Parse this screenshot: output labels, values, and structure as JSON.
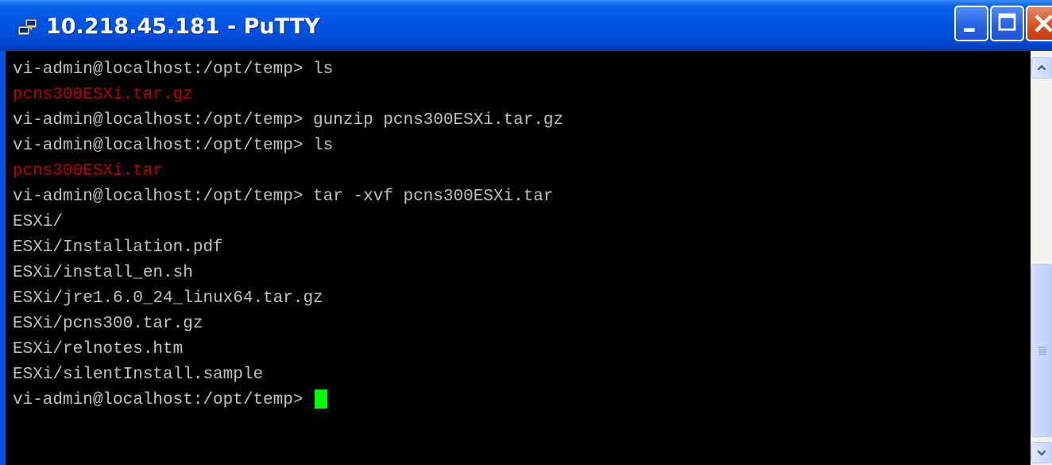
{
  "window": {
    "title": "10.218.45.181 - PuTTY",
    "icon": "putty-icon",
    "controls": [
      "minimize-icon",
      "maximize-icon",
      "close-icon"
    ]
  },
  "terminal": {
    "lines": [
      {
        "text": "vi-admin@localhost:/opt/temp> ls",
        "color": "#c0c0c0"
      },
      {
        "text": "pcns300ESXi.tar.gz",
        "color": "#bb0000"
      },
      {
        "text": "vi-admin@localhost:/opt/temp> gunzip pcns300ESXi.tar.gz",
        "color": "#c0c0c0"
      },
      {
        "text": "vi-admin@localhost:/opt/temp> ls",
        "color": "#c0c0c0"
      },
      {
        "text": "pcns300ESXi.tar",
        "color": "#bb0000"
      },
      {
        "text": "vi-admin@localhost:/opt/temp> tar -xvf pcns300ESXi.tar",
        "color": "#c0c0c0"
      },
      {
        "text": "ESXi/",
        "color": "#c0c0c0"
      },
      {
        "text": "ESXi/Installation.pdf",
        "color": "#c0c0c0"
      },
      {
        "text": "ESXi/install_en.sh",
        "color": "#c0c0c0"
      },
      {
        "text": "ESXi/jre1.6.0_24_linux64.tar.gz",
        "color": "#c0c0c0"
      },
      {
        "text": "ESXi/pcns300.tar.gz",
        "color": "#c0c0c0"
      },
      {
        "text": "ESXi/relnotes.htm",
        "color": "#c0c0c0"
      },
      {
        "text": "ESXi/silentInstall.sample",
        "color": "#c0c0c0"
      }
    ],
    "prompt": "vi-admin@localhost:/opt/temp> ",
    "cursor_color": "#00ff00",
    "background": "#000000"
  },
  "scrollbar": {
    "icons": [
      "scroll-up-icon",
      "scroll-down-icon",
      "scroll-grip-icon"
    ]
  }
}
